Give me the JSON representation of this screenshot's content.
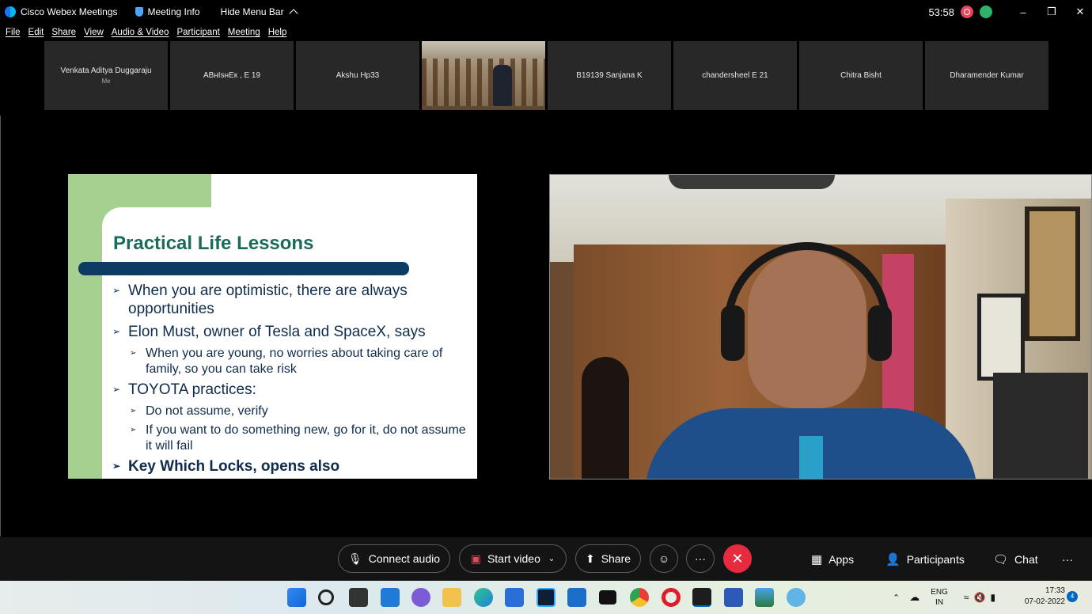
{
  "titlebar": {
    "app_name": "Cisco Webex Meetings",
    "meeting_info": "Meeting Info",
    "hide_menu": "Hide Menu Bar",
    "timer": "53:58"
  },
  "menu": [
    "File",
    "Edit",
    "Share",
    "View",
    "Audio & Video",
    "Participant",
    "Meeting",
    "Help"
  ],
  "participants": [
    {
      "name": "Venkata Aditya Duggaraju",
      "sub": "Me"
    },
    {
      "name": "ABнIsнEк , E 19",
      "sub": ""
    },
    {
      "name": "Akshu Hp33",
      "sub": ""
    },
    {
      "name": "",
      "sub": "",
      "video": true
    },
    {
      "name": "B19139 Sanjana K",
      "sub": ""
    },
    {
      "name": "chandersheel E 21",
      "sub": ""
    },
    {
      "name": "Chitra Bisht",
      "sub": ""
    },
    {
      "name": "Dharamender Kumar",
      "sub": ""
    }
  ],
  "slide": {
    "title": "Practical Life Lessons",
    "bullets": [
      {
        "text": "When you are optimistic, there are always opportunities",
        "level": 1
      },
      {
        "text": "Elon Must, owner of Tesla and SpaceX, says",
        "level": 1
      },
      {
        "text": "When you are young, no worries about taking care of family, so you can take risk",
        "level": 2
      },
      {
        "text": "TOYOTA practices:",
        "level": 1
      },
      {
        "text": "Do not assume, verify",
        "level": 2
      },
      {
        "text": "If you want to do something new, go for it, do not assume it will fail",
        "level": 2
      },
      {
        "text": "Key Which Locks, opens also",
        "level": 1,
        "bold": true
      }
    ]
  },
  "controls": {
    "connect_audio": "Connect audio",
    "start_video": "Start video",
    "share": "Share",
    "apps": "Apps",
    "participants": "Participants",
    "chat": "Chat",
    "more": "···",
    "ellipsis": "···"
  },
  "taskbar": {
    "lang_top": "ENG",
    "lang_bottom": "IN",
    "time": "17:33",
    "date": "07-02-2022",
    "notifications": "4"
  },
  "colors": {
    "end_button": "#e62b3e",
    "slide_title": "#1a6b5a",
    "slide_bar": "#0c3b63",
    "slide_green": "#a6d08f"
  }
}
